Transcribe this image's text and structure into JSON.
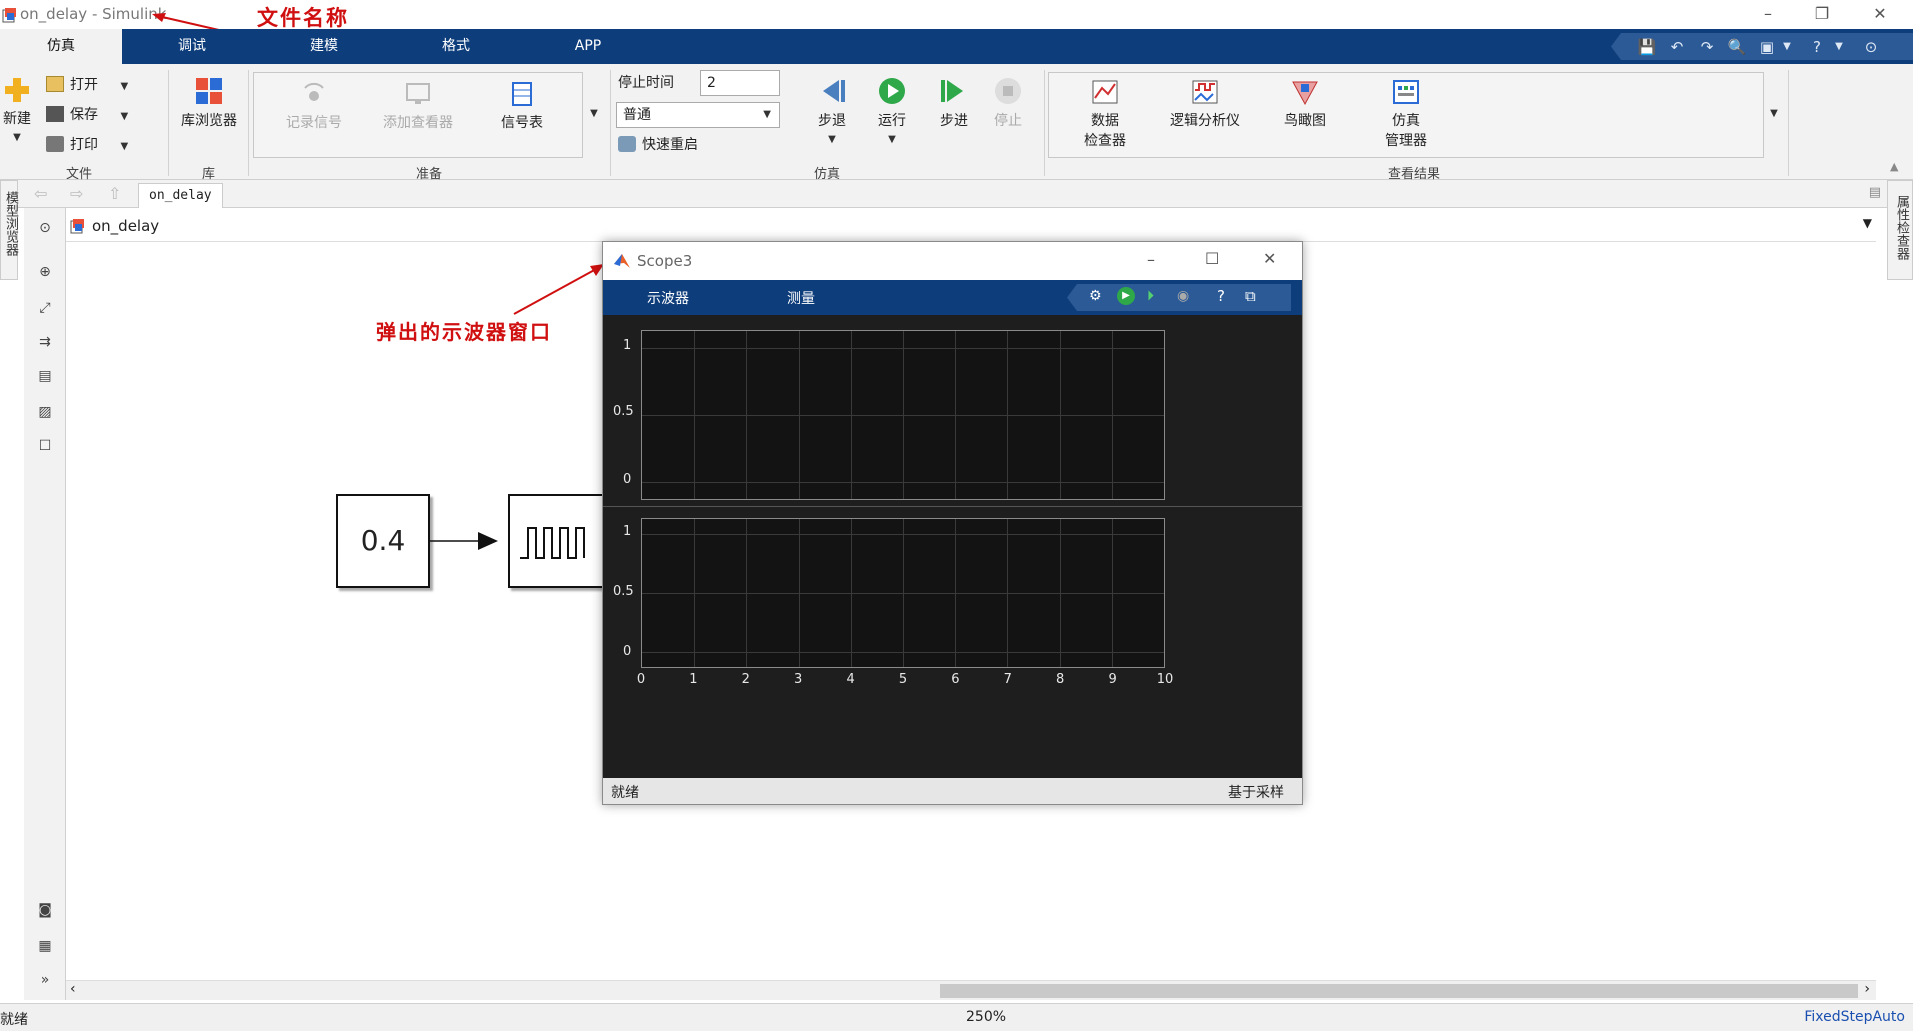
{
  "window": {
    "title": "on_delay - Simulink",
    "annotation_filename": "文件名称",
    "annotation_scope": "弹出的示波器窗口"
  },
  "tabs": [
    "仿真",
    "调试",
    "建模",
    "格式",
    "APP"
  ],
  "ribbon": {
    "file": {
      "new_label": "新建",
      "open_label": "打开",
      "save_label": "保存",
      "print_label": "打印",
      "group_label": "文件"
    },
    "library": {
      "browser_label": "库浏览器",
      "group_label": "库"
    },
    "prepare": {
      "record_label": "记录信号",
      "add_viewer_label": "添加查看器",
      "signal_table_label": "信号表",
      "group_label": "准备"
    },
    "simulate": {
      "stop_time_label": "停止时间",
      "stop_time_value": "2",
      "mode_value": "普通",
      "fast_restart_label": "快速重启",
      "step_back_label": "步退",
      "run_label": "运行",
      "step_forward_label": "步进",
      "stop_label": "停止",
      "group_label": "仿真"
    },
    "results": {
      "data_inspector_label_1": "数据",
      "data_inspector_label_2": "检查器",
      "logic_analyzer_label": "逻辑分析仪",
      "birdseye_label": "鸟瞰图",
      "sim_manager_label_1": "仿真",
      "sim_manager_label_2": "管理器",
      "group_label": "查看结果"
    }
  },
  "explorer": {
    "tab_label": "on_delay",
    "address": "on_delay"
  },
  "side_panels": {
    "left_label": "模型浏览器",
    "right_label": "属性检查器"
  },
  "canvas": {
    "constant_value": "0.4"
  },
  "scope": {
    "title": "Scope3",
    "tab_scope": "示波器",
    "tab_measure": "测量",
    "status_left": "就绪",
    "status_right": "基于采样",
    "plot1_yticks": [
      "1",
      "0.5",
      "0"
    ],
    "plot2_yticks": [
      "1",
      "0.5",
      "0"
    ],
    "xticks": [
      "0",
      "1",
      "2",
      "3",
      "4",
      "5",
      "6",
      "7",
      "8",
      "9",
      "10"
    ]
  },
  "statusbar": {
    "left": "就绪",
    "zoom": "250%",
    "solver": "FixedStepAuto"
  },
  "colors": {
    "tab_bar": "#0e3d7b",
    "annotation": "#d01010",
    "scope_bg": "#1e1e1e",
    "solver_text": "#1a4fb0"
  }
}
